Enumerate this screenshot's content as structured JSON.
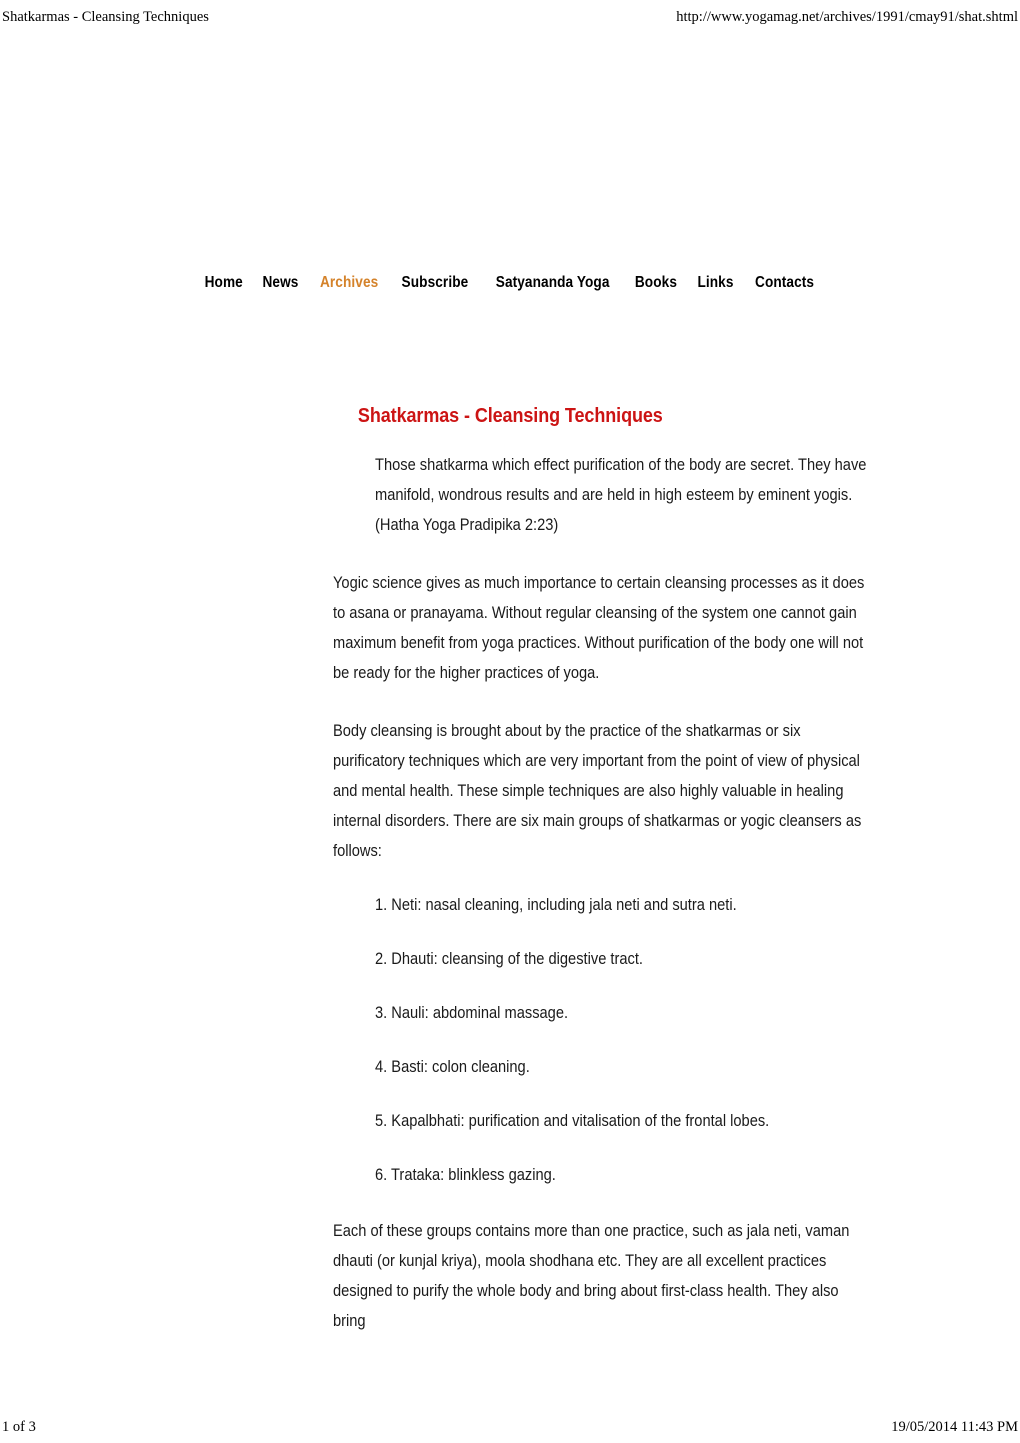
{
  "print_header": {
    "document_title": "Shatkarmas - Cleansing Techniques",
    "url": "http://www.yogamag.net/archives/1991/cmay91/shat.shtml"
  },
  "print_footer": {
    "page_indicator": "1 of 3",
    "timestamp": "19/05/2014 11:43 PM"
  },
  "colors": {
    "page_background": "#ffffff",
    "text": "#1a1a1a",
    "title_red": "#cc1414",
    "nav_active_orange": "#d4822a",
    "nav_default": "#000000"
  },
  "nav": {
    "items": [
      {
        "label": "Home",
        "active": false
      },
      {
        "label": "News",
        "active": false
      },
      {
        "label": "Archives",
        "active": true
      },
      {
        "label": "Subscribe",
        "active": false
      },
      {
        "label": "Satyananda Yoga",
        "active": false
      },
      {
        "label": "Books",
        "active": false
      },
      {
        "label": "Links",
        "active": false
      },
      {
        "label": "Contacts",
        "active": false
      }
    ]
  },
  "article": {
    "title": "Shatkarmas - Cleansing Techniques",
    "quote": {
      "text": "Those shatkarma which effect purification of the body are secret. They have manifold, wondrous results and are held in high esteem by eminent yogis.",
      "attribution": "(Hatha Yoga Pradipika 2:23)"
    },
    "paragraph_1": "Yogic science gives as much importance to certain cleansing processes as it does to asana or pranayama. Without regular cleansing of the system one cannot gain maximum benefit from yoga practices. Without purification of the body one will not be ready for the higher practices of yoga.",
    "paragraph_2": "Body cleansing is brought about by the practice of the shatkarmas or six purificatory techniques which are very important from the point of view of physical and mental health. These simple techniques are also highly valuable in healing internal disorders. There are six main groups of shatkarmas or yogic cleansers as follows:",
    "practices": [
      "1. Neti: nasal cleaning, including jala neti and sutra neti.",
      "2. Dhauti: cleansing of the digestive tract.",
      "3. Nauli: abdominal massage.",
      "4. Basti: colon cleaning.",
      "5. Kapalbhati: purification and vitalisation of the frontal lobes.",
      "6. Trataka: blinkless gazing."
    ],
    "paragraph_3": "Each of these groups contains more than one practice, such as jala neti, vaman dhauti (or kunjal kriya), moola shodhana etc. They are all excellent practices designed to purify the whole body and bring about first-class health. They also bring"
  }
}
